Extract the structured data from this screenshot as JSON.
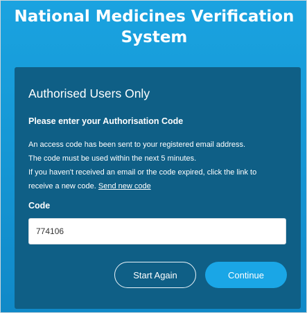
{
  "app": {
    "title_line1": "National Medicines Verification",
    "title_line2": "System"
  },
  "card": {
    "heading": "Authorised Users Only",
    "subheading": "Please enter your Authorisation Code",
    "info_lines": [
      "An access code has been sent to your registered email address.",
      "The code must be used within the next 5 minutes.",
      "If you haven't received an email or the code expired, click the link to",
      "receive a new code."
    ],
    "send_new_code_link": "Send new code",
    "code_label": "Code",
    "code_value": "774106",
    "start_again_label": "Start Again",
    "continue_label": "Continue"
  },
  "colors": {
    "background": "#1595d3",
    "card": "#0f5f86",
    "continue_button": "#1aa6e6"
  }
}
